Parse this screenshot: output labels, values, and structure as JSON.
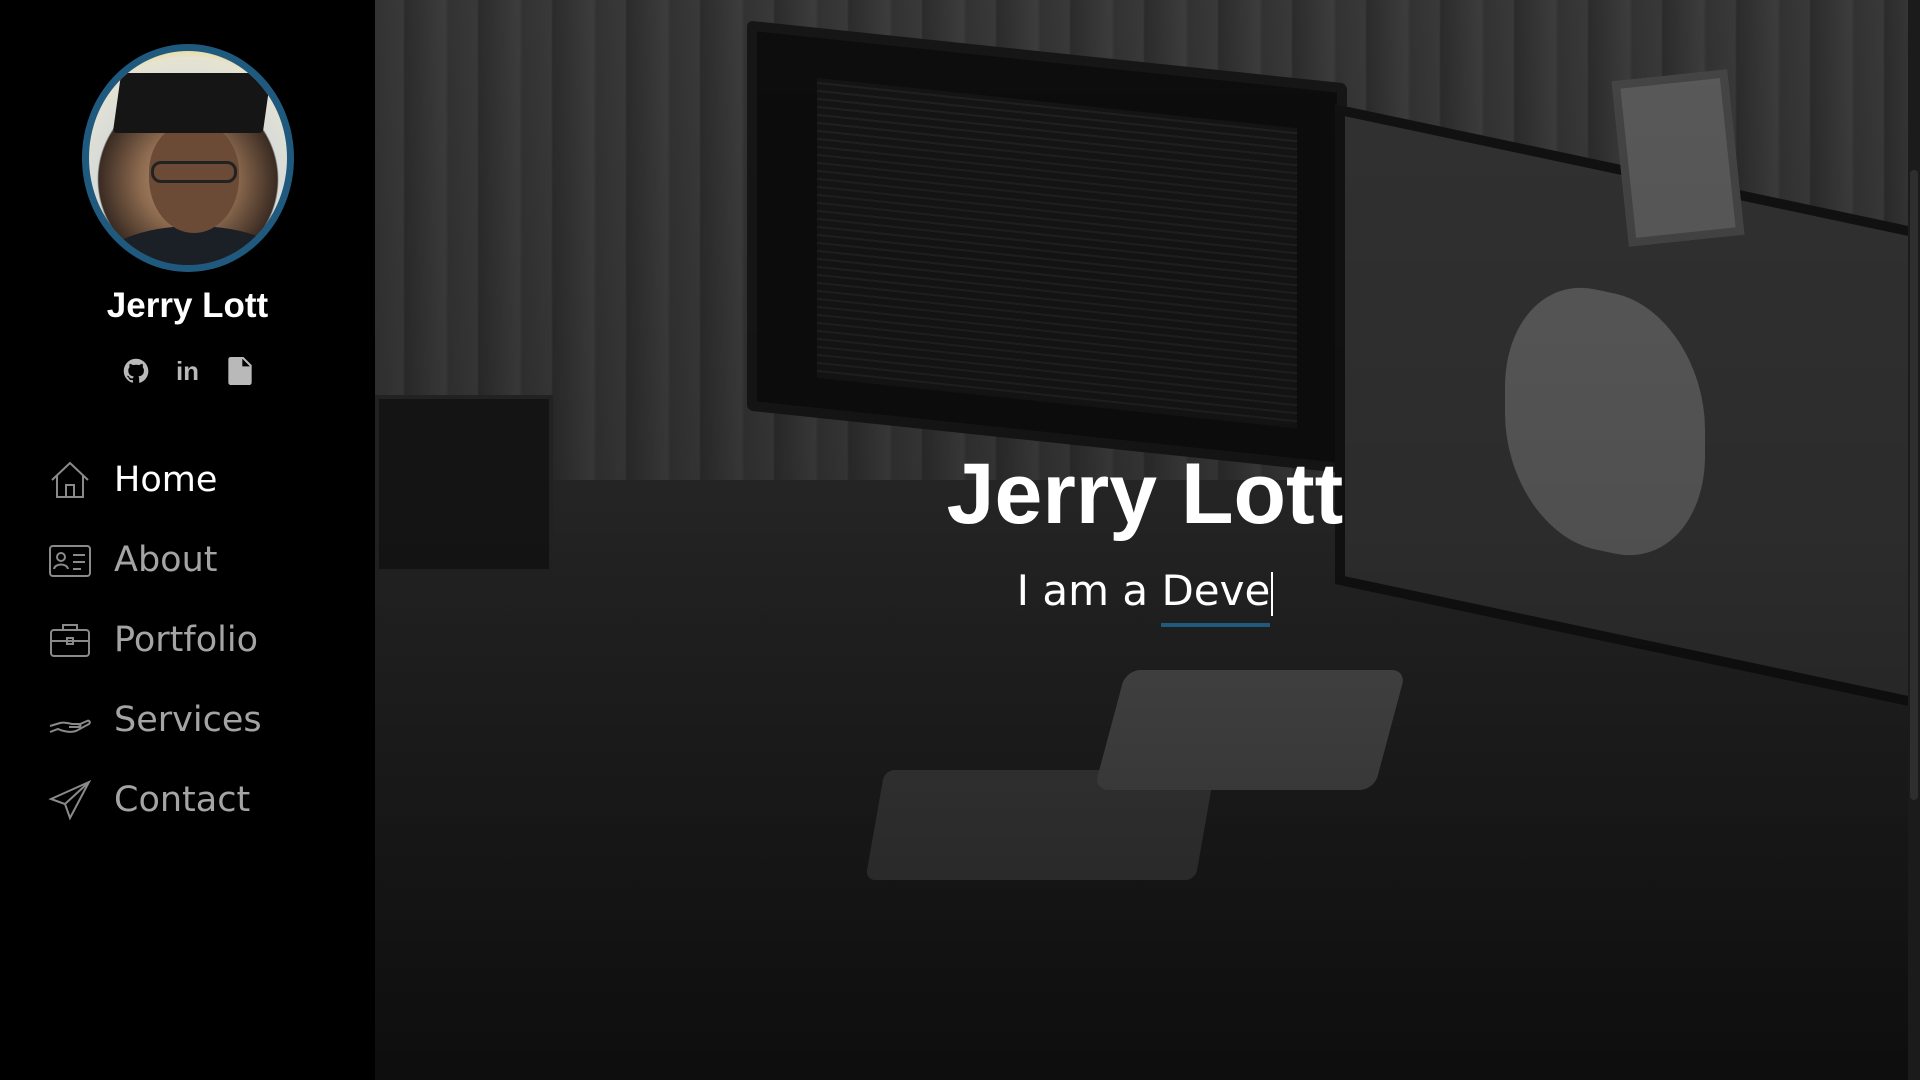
{
  "sidebar": {
    "profile_name": "Jerry Lott",
    "social": [
      {
        "icon": "github-icon"
      },
      {
        "icon": "linkedin-icon",
        "glyph": "in"
      },
      {
        "icon": "pdf-resume-icon"
      }
    ],
    "nav": [
      {
        "label": "Home",
        "icon": "home-icon",
        "active": true
      },
      {
        "label": "About",
        "icon": "id-card-icon",
        "active": false
      },
      {
        "label": "Portfolio",
        "icon": "briefcase-icon",
        "active": false
      },
      {
        "label": "Services",
        "icon": "hand-icon",
        "active": false
      },
      {
        "label": "Contact",
        "icon": "paper-plane-icon",
        "active": false
      }
    ]
  },
  "hero": {
    "title": "Jerry Lott",
    "subtitle_prefix": "I am a ",
    "subtitle_typed": "Deve"
  },
  "colors": {
    "accent": "#1f5a7e",
    "sidebar_bg": "#000000",
    "nav_text": "#a4a4a4",
    "nav_text_active": "#ffffff"
  }
}
